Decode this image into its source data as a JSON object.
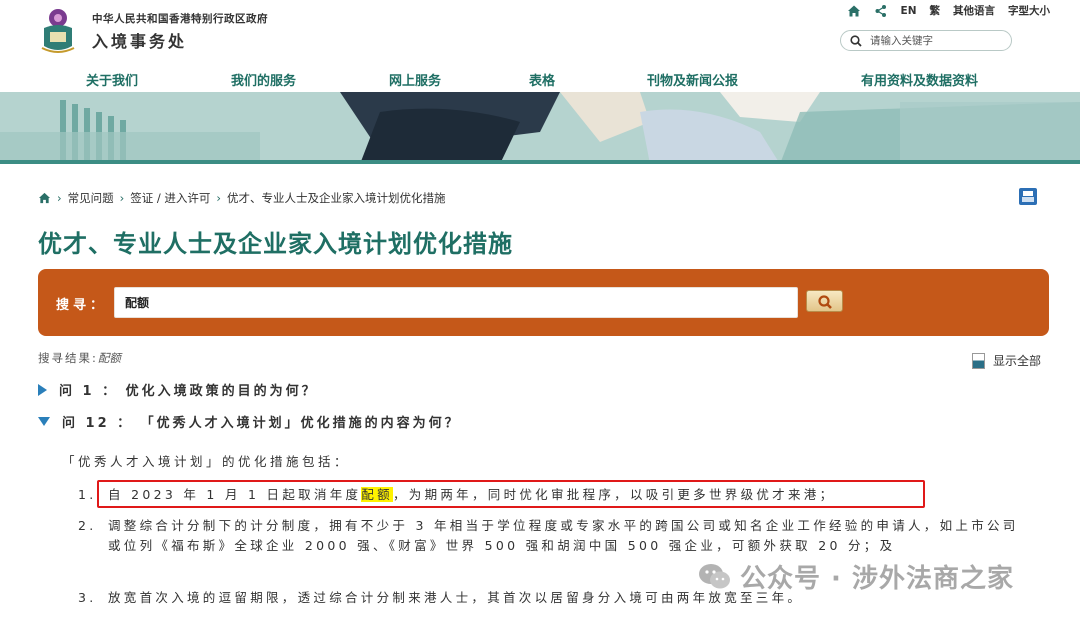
{
  "header": {
    "gov_line": "中华人民共和国香港特别行政区政府",
    "dept_name": "入境事务处",
    "topnav": {
      "en": "EN",
      "trad": "繁",
      "other_lang": "其他语言",
      "font_size": "字型大小"
    },
    "search_placeholder": "请输入关键字"
  },
  "mainnav": {
    "items": [
      "关于我们",
      "我们的服务",
      "网上服务",
      "表格",
      "刊物及新闻公报",
      "有用资料及数据资料"
    ]
  },
  "breadcrumb": {
    "items": [
      "常见问题",
      "签证 / 进入许可",
      "优才、专业人士及企业家入境计划优化措施"
    ]
  },
  "page_title": "优才、专业人士及企业家入境计划优化措施",
  "search": {
    "label": "搜寻：",
    "value": "配额"
  },
  "results": {
    "label": "搜寻结果:",
    "keyword": "配额",
    "show_all": "显示全部",
    "questions": [
      {
        "label": "问 1 ： 优化入境政策的目的为何？",
        "expanded": false
      },
      {
        "label": "问 12 ： 「优秀人才入境计划」优化措施的内容为何？",
        "expanded": true
      }
    ],
    "answer_intro": "「优秀人才入境计划」的优化措施包括：",
    "answer_items": [
      {
        "num": "1.",
        "before": "自 2023 年 1 月 1 日起取消年度",
        "highlight": "配额",
        "after": "，为期两年，同时优化审批程序，以吸引更多世界级优才来港；"
      },
      {
        "num": "2.",
        "text": "调整综合计分制下的计分制度，拥有不少于 3 年相当于学位程度或专家水平的跨国公司或知名企业工作经验的申请人，如上市公司或位列《福布斯》全球企业 2000 强、《财富》世界 500 强和胡润中国 500 强企业，可额外获取 20 分；及"
      },
      {
        "num": "3.",
        "text": "放宽首次入境的逗留期限，透过综合计分制来港人士，其首次以居留身分入境可由两年放宽至三年。"
      }
    ]
  },
  "watermark": {
    "text": "公众号 · 涉外法商之家"
  },
  "colors": {
    "brand_green": "#1f6f64",
    "search_orange": "#c55819",
    "highlight_yellow": "#fff200",
    "annotation_red": "#e01919"
  }
}
